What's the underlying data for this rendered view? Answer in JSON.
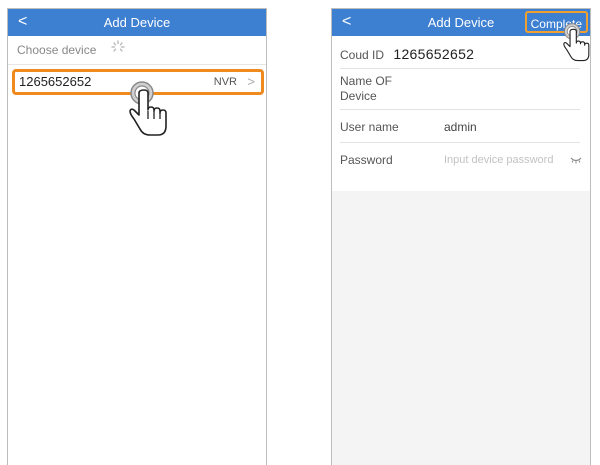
{
  "left": {
    "title": "Add Device",
    "back_glyph": "<",
    "choose_label": "Choose device",
    "device_id": "1265652652",
    "device_type": "NVR",
    "chevron": ">"
  },
  "right": {
    "title": "Add Device",
    "back_glyph": "<",
    "complete_label": "Complete",
    "cloud_id_label": "Coud ID",
    "cloud_id_value": "1265652652",
    "name_label_line1": "Name OF",
    "name_label_line2": "Device",
    "username_label": "User name",
    "username_value": "admin",
    "password_label": "Password",
    "password_placeholder": "Input device password"
  },
  "colors": {
    "header": "#3d7fd1",
    "highlight": "#ef8a1f"
  }
}
